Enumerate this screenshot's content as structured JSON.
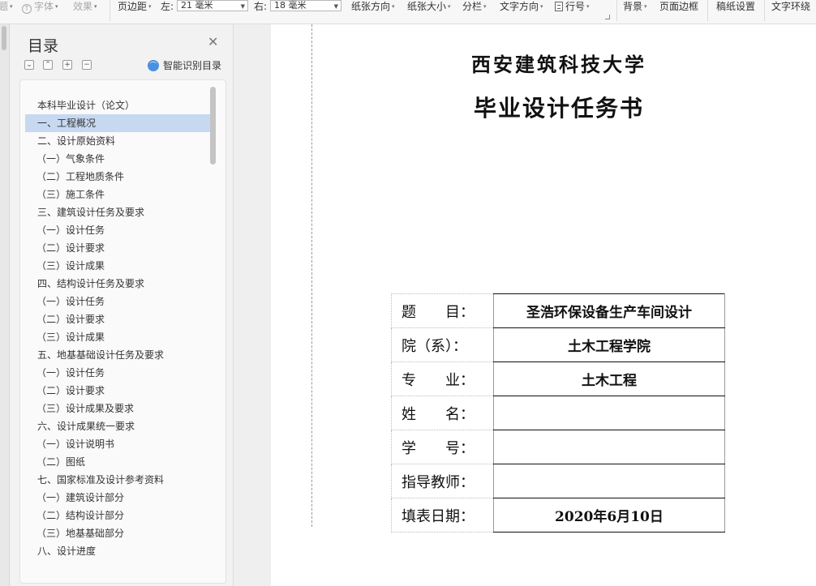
{
  "toolbar": {
    "items": [
      {
        "label": "题",
        "dim": true
      },
      {
        "label": "字体",
        "dim": true
      },
      {
        "label": "效果",
        "dim": true
      },
      {
        "label": "页边距"
      },
      {
        "label": "左:"
      },
      {
        "label": "右:"
      },
      {
        "label": "纸张方向"
      },
      {
        "label": "纸张大小"
      },
      {
        "label": "分栏"
      },
      {
        "label": "文字方向"
      },
      {
        "label": "行号"
      },
      {
        "label": "背景"
      },
      {
        "label": "页面边框"
      },
      {
        "label": "稿纸设置"
      },
      {
        "label": "文字环绕"
      }
    ],
    "margin_left_value": "21 毫米",
    "margin_right_value": "18 毫米"
  },
  "toc": {
    "title": "目录",
    "smart_label": "智能识别目录",
    "selected_index": 1,
    "items": [
      "本科毕业设计（论文）",
      "一、工程概况",
      "二、设计原始资料",
      "（一）气象条件",
      "（二）工程地质条件",
      "（三）施工条件",
      "三、建筑设计任务及要求",
      "（一）设计任务",
      "（二）设计要求",
      "（三）设计成果",
      "四、结构设计任务及要求",
      "（一）设计任务",
      "（二）设计要求",
      "（三）设计成果",
      "五、地基基础设计任务及要求",
      "（一）设计任务",
      "（二）设计要求",
      "（三）设计成果及要求",
      "六、设计成果统一要求",
      "（一）设计说明书",
      "（二）图纸",
      "七、国家标准及设计参考资料",
      "（一）建筑设计部分",
      "（二）结构设计部分",
      "（三）地基基础部分",
      "八、设计进度"
    ]
  },
  "document": {
    "school": "西安建筑科技大学",
    "heading": "毕业设计任务书",
    "rows": [
      {
        "label": "题　　目：",
        "value": "圣浩环保设备生产车间设计"
      },
      {
        "label": "院（系）：",
        "value": "土木工程学院"
      },
      {
        "label": "专　　业：",
        "value": "土木工程"
      },
      {
        "label": "姓　　名：",
        "value": ""
      },
      {
        "label": "学　　号：",
        "value": ""
      },
      {
        "label": "指导教师：",
        "value": ""
      },
      {
        "label": "填表日期：",
        "value": "2020年6月10日"
      }
    ]
  }
}
